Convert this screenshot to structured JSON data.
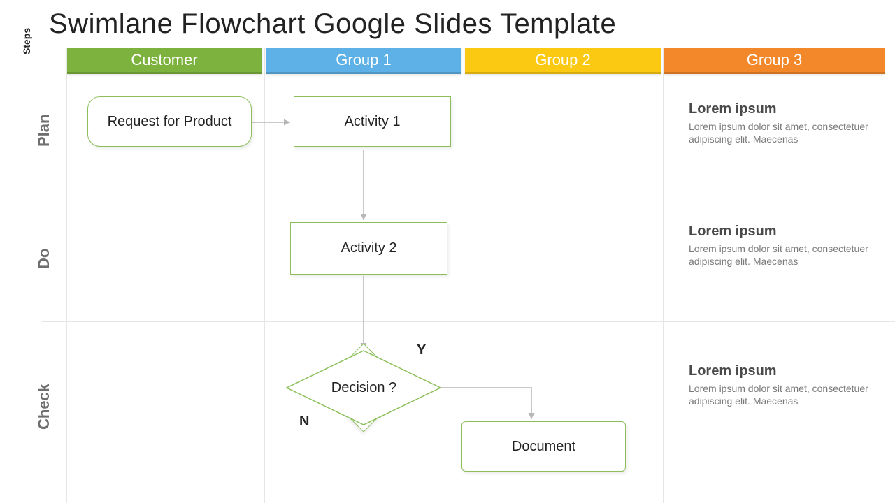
{
  "title": "Swimlane Flowchart Google Slides Template",
  "steps_label": "Steps",
  "lanes": {
    "customer": "Customer",
    "group1": "Group 1",
    "group2": "Group 2",
    "group3": "Group 3"
  },
  "rows": {
    "plan": "Plan",
    "do": "Do",
    "check": "Check"
  },
  "nodes": {
    "request": "Request for Product",
    "activity1": "Activity 1",
    "activity2": "Activity 2",
    "decision": "Decision ?",
    "document": "Document"
  },
  "decision_labels": {
    "yes": "Y",
    "no": "N"
  },
  "side_text": {
    "plan": {
      "heading": "Lorem ipsum",
      "body": "Lorem ipsum dolor sit amet, consectetuer adipiscing elit. Maecenas"
    },
    "do": {
      "heading": "Lorem ipsum",
      "body": "Lorem ipsum dolor sit amet, consectetuer adipiscing elit. Maecenas"
    },
    "check": {
      "heading": "Lorem ipsum",
      "body": "Lorem ipsum dolor sit amet, consectetuer adipiscing elit. Maecenas"
    }
  },
  "colors": {
    "green": "#7db23e",
    "blue": "#5eb1e6",
    "yellow": "#fcc912",
    "orange": "#f2882a",
    "node_border": "#8cbf5a",
    "arrow": "#b7b7b7"
  }
}
